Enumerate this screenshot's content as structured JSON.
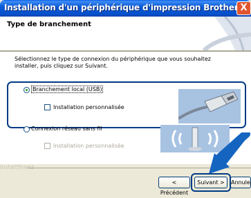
{
  "window": {
    "title": "Installation d'un périphérique d'impression Brother",
    "close_label": "X"
  },
  "header": {
    "title": "Type de branchement"
  },
  "instruction": "Sélectionnez le type de connexion du périphérique que vous souhaitez installer, puis cliquez sur Suivant.",
  "options": {
    "local": {
      "label": "Branchement local (USB)",
      "selected": true,
      "custom_install_label": "Installation personnalisée",
      "custom_install_checked": false
    },
    "wireless": {
      "label": "Connexion réseau sans fil",
      "selected": false,
      "custom_install_label": "Installation personnalisée",
      "custom_install_checked": false,
      "custom_install_enabled": false
    }
  },
  "footer": {
    "brand": "InstallShield",
    "back_label": "< Précédent",
    "next_label": "Suivant >",
    "cancel_label": "Annuler"
  },
  "colors": {
    "titlebar": "#0b5ad6",
    "highlight": "#003a86",
    "arrow": "#1565c0"
  }
}
